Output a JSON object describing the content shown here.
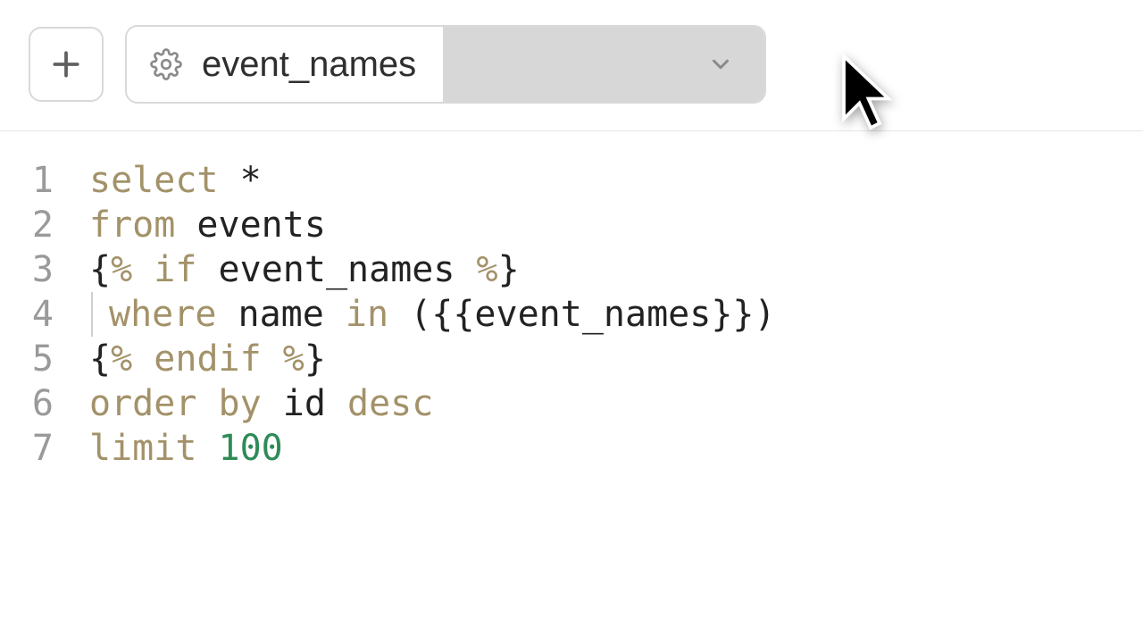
{
  "toolbar": {
    "param_name": "event_names"
  },
  "editor": {
    "lines": [
      {
        "n": "1",
        "tokens": [
          {
            "t": "select",
            "c": "kw"
          },
          {
            "t": " * ",
            "c": "txt",
            "trim": " *"
          }
        ]
      },
      {
        "n": "2",
        "tokens": [
          {
            "t": "from",
            "c": "kw"
          },
          {
            "t": " events",
            "c": "txt"
          }
        ]
      },
      {
        "n": "3",
        "tokens": [
          {
            "t": "{",
            "c": "txt"
          },
          {
            "t": "%",
            "c": "kw"
          },
          {
            "t": " ",
            "c": "txt"
          },
          {
            "t": "if",
            "c": "kw"
          },
          {
            "t": " event_names ",
            "c": "txt"
          },
          {
            "t": "%",
            "c": "kw"
          },
          {
            "t": "}",
            "c": "txt"
          }
        ]
      },
      {
        "n": "4",
        "indent": true,
        "tokens": [
          {
            "t": "where",
            "c": "kw"
          },
          {
            "t": " name ",
            "c": "txt"
          },
          {
            "t": "in",
            "c": "kw"
          },
          {
            "t": " ({{event_names}})",
            "c": "txt"
          }
        ]
      },
      {
        "n": "5",
        "tokens": [
          {
            "t": "{",
            "c": "txt"
          },
          {
            "t": "%",
            "c": "kw"
          },
          {
            "t": " ",
            "c": "txt"
          },
          {
            "t": "endif",
            "c": "kw"
          },
          {
            "t": " ",
            "c": "txt"
          },
          {
            "t": "%",
            "c": "kw"
          },
          {
            "t": "}",
            "c": "txt"
          }
        ]
      },
      {
        "n": "6",
        "tokens": [
          {
            "t": "order by",
            "c": "kw"
          },
          {
            "t": " id ",
            "c": "txt"
          },
          {
            "t": "desc",
            "c": "kw"
          }
        ]
      },
      {
        "n": "7",
        "tokens": [
          {
            "t": "limit",
            "c": "kw"
          },
          {
            "t": " ",
            "c": "txt"
          },
          {
            "t": "100",
            "c": "num"
          }
        ]
      }
    ]
  }
}
